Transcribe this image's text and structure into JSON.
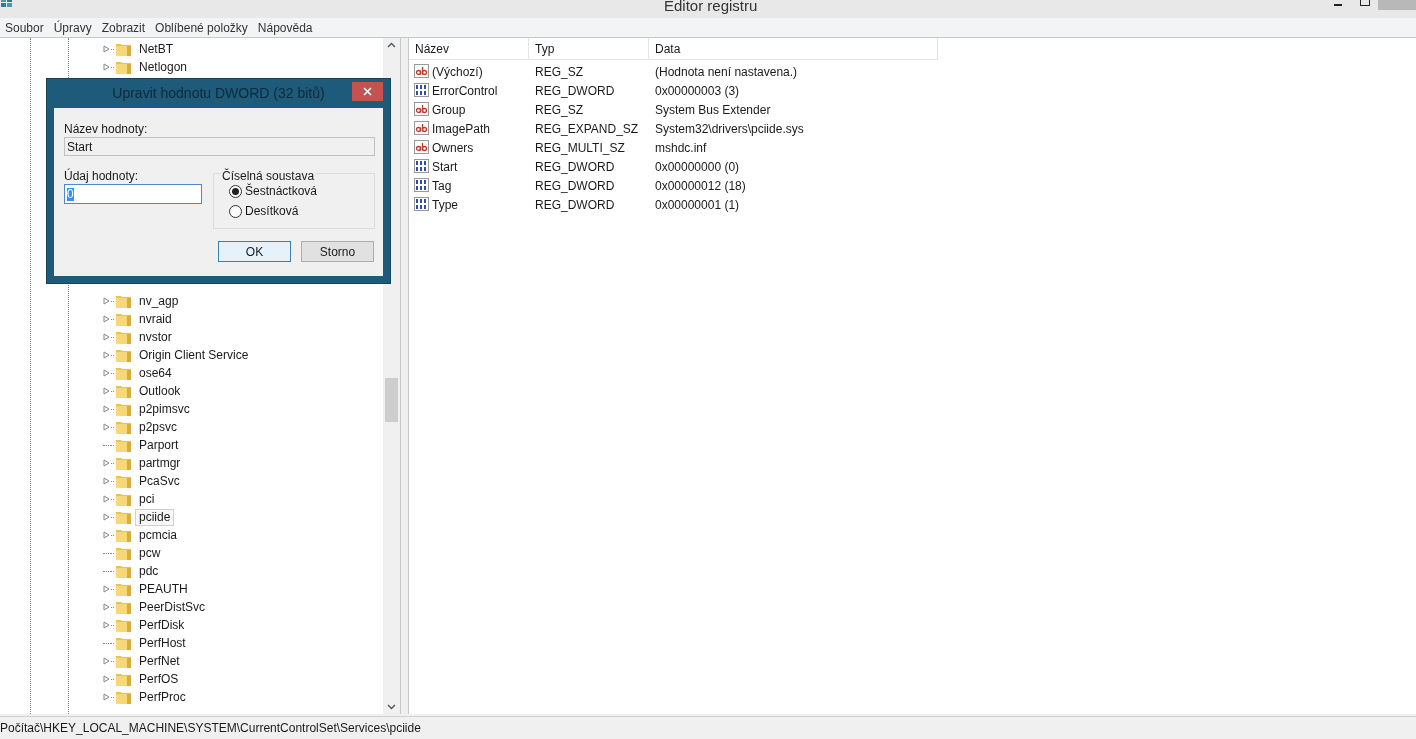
{
  "window": {
    "title": "Editor registru"
  },
  "menu": [
    "Soubor",
    "Úpravy",
    "Zobrazit",
    "Oblíbené položky",
    "Nápověda"
  ],
  "tree": {
    "items_before": [
      {
        "label": "NetBT",
        "expandable": true,
        "selected": false
      },
      {
        "label": "Netlogon",
        "expandable": true,
        "selected": false
      }
    ],
    "items_after": [
      {
        "label": "nv_agp",
        "expandable": true,
        "selected": false
      },
      {
        "label": "nvraid",
        "expandable": true,
        "selected": false
      },
      {
        "label": "nvstor",
        "expandable": true,
        "selected": false
      },
      {
        "label": "Origin Client Service",
        "expandable": true,
        "selected": false
      },
      {
        "label": "ose64",
        "expandable": true,
        "selected": false
      },
      {
        "label": "Outlook",
        "expandable": true,
        "selected": false
      },
      {
        "label": "p2pimsvc",
        "expandable": true,
        "selected": false
      },
      {
        "label": "p2psvc",
        "expandable": true,
        "selected": false
      },
      {
        "label": "Parport",
        "expandable": false,
        "selected": false
      },
      {
        "label": "partmgr",
        "expandable": true,
        "selected": false
      },
      {
        "label": "PcaSvc",
        "expandable": true,
        "selected": false
      },
      {
        "label": "pci",
        "expandable": true,
        "selected": false
      },
      {
        "label": "pciide",
        "expandable": true,
        "selected": true
      },
      {
        "label": "pcmcia",
        "expandable": true,
        "selected": false
      },
      {
        "label": "pcw",
        "expandable": false,
        "selected": false
      },
      {
        "label": "pdc",
        "expandable": false,
        "selected": false
      },
      {
        "label": "PEAUTH",
        "expandable": true,
        "selected": false
      },
      {
        "label": "PeerDistSvc",
        "expandable": true,
        "selected": false
      },
      {
        "label": "PerfDisk",
        "expandable": true,
        "selected": false
      },
      {
        "label": "PerfHost",
        "expandable": false,
        "selected": false
      },
      {
        "label": "PerfNet",
        "expandable": true,
        "selected": false
      },
      {
        "label": "PerfOS",
        "expandable": true,
        "selected": false
      },
      {
        "label": "PerfProc",
        "expandable": true,
        "selected": false
      }
    ]
  },
  "values": {
    "columns": [
      "Název",
      "Typ",
      "Data"
    ],
    "rows": [
      {
        "kind": "string",
        "name": "(Výchozí)",
        "type": "REG_SZ",
        "data": "(Hodnota není nastavena.)"
      },
      {
        "kind": "binary",
        "name": "ErrorControl",
        "type": "REG_DWORD",
        "data": "0x00000003 (3)"
      },
      {
        "kind": "string",
        "name": "Group",
        "type": "REG_SZ",
        "data": "System Bus Extender"
      },
      {
        "kind": "string",
        "name": "ImagePath",
        "type": "REG_EXPAND_SZ",
        "data": "System32\\drivers\\pciide.sys"
      },
      {
        "kind": "string",
        "name": "Owners",
        "type": "REG_MULTI_SZ",
        "data": "mshdc.inf"
      },
      {
        "kind": "binary",
        "name": "Start",
        "type": "REG_DWORD",
        "data": "0x00000000 (0)"
      },
      {
        "kind": "binary",
        "name": "Tag",
        "type": "REG_DWORD",
        "data": "0x00000012 (18)"
      },
      {
        "kind": "binary",
        "name": "Type",
        "type": "REG_DWORD",
        "data": "0x00000001 (1)"
      }
    ]
  },
  "dialog": {
    "title": "Upravit hodnotu DWORD (32 bitů)",
    "name_label": "Název hodnoty:",
    "name_value": "Start",
    "data_label": "Údaj hodnoty:",
    "data_value": "0",
    "base_label": "Číselná soustava",
    "bases": [
      {
        "label": "Šestnáctková",
        "selected": true
      },
      {
        "label": "Desítková",
        "selected": false
      }
    ],
    "buttons": [
      "OK",
      "Storno"
    ]
  },
  "status_bar": "Počítač\\HKEY_LOCAL_MACHINE\\SYSTEM\\CurrentControlSet\\Services\\pciide"
}
